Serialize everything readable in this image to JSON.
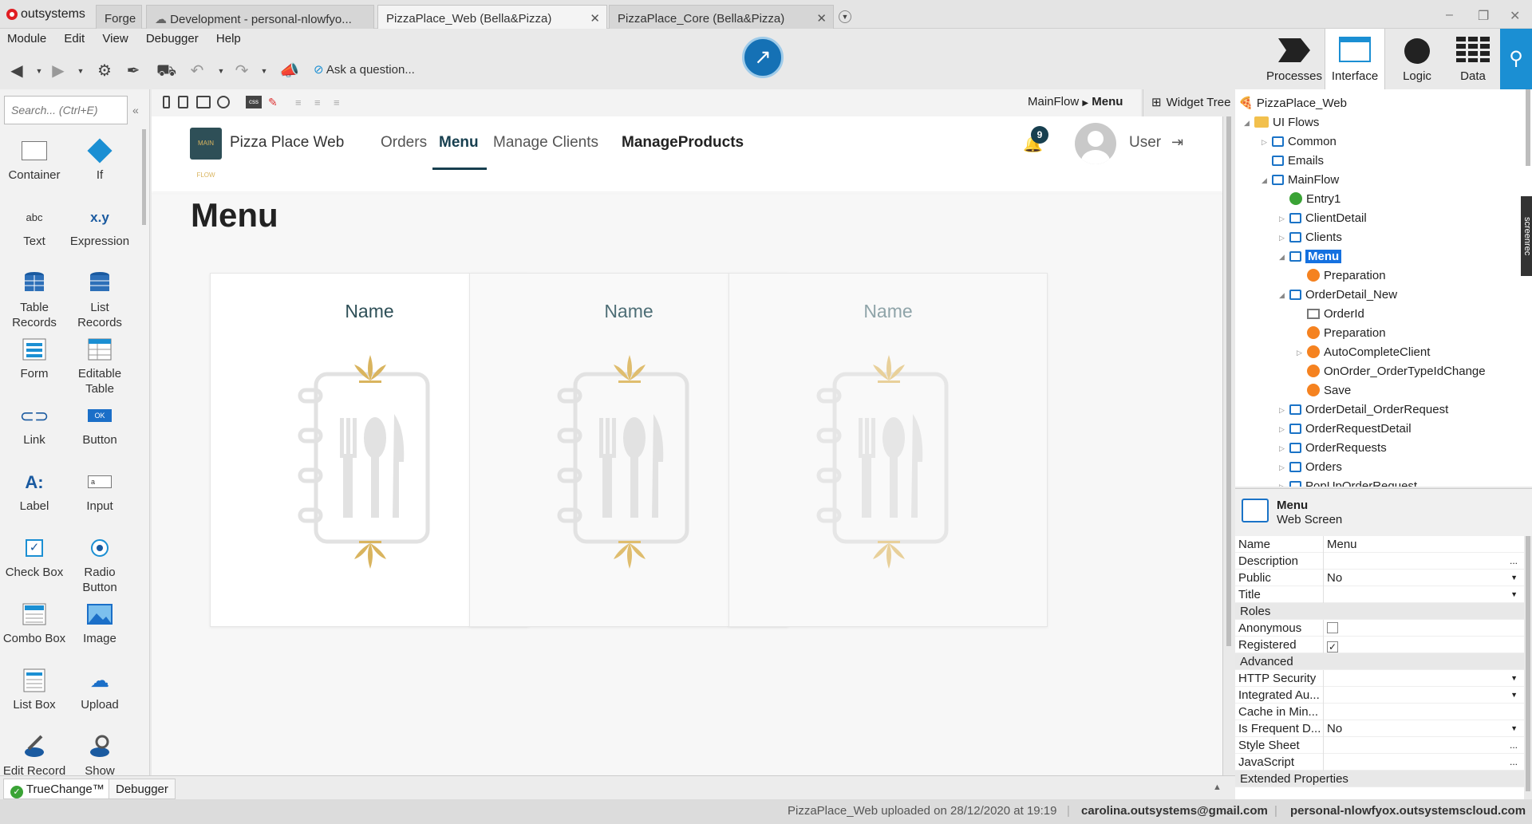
{
  "tabs": {
    "app_logo": "outsystems",
    "items": [
      {
        "label": "Forge"
      },
      {
        "label": "Development - personal-nlowfyo..."
      },
      {
        "label": "PizzaPlace_Web (Bella&Pizza)"
      },
      {
        "label": "PizzaPlace_Core (Bella&Pizza)"
      }
    ]
  },
  "menu": [
    "Module",
    "Edit",
    "View",
    "Debugger",
    "Help"
  ],
  "toolbar": {
    "ask": "Ask a question..."
  },
  "ribbon": {
    "processes": "Processes",
    "interface": "Interface",
    "logic": "Logic",
    "data": "Data"
  },
  "toolbox": {
    "search_placeholder": "Search... (Ctrl+E)",
    "widgets": [
      {
        "label": "Container"
      },
      {
        "label": "If"
      },
      {
        "label": "Text"
      },
      {
        "label": "Expression"
      },
      {
        "label": "Table Records"
      },
      {
        "label": "List Records"
      },
      {
        "label": "Form"
      },
      {
        "label": "Editable Table"
      },
      {
        "label": "Link"
      },
      {
        "label": "Button"
      },
      {
        "label": "Label"
      },
      {
        "label": "Input"
      },
      {
        "label": "Check Box"
      },
      {
        "label": "Radio Button"
      },
      {
        "label": "Combo Box"
      },
      {
        "label": "Image"
      },
      {
        "label": "List Box"
      },
      {
        "label": "Upload"
      },
      {
        "label": "Edit Record"
      },
      {
        "label": "Show"
      }
    ],
    "icons": {
      "text": "abc",
      "expression": "x.y",
      "button": "OK",
      "label": "A:"
    }
  },
  "breadcrumb": {
    "flow": "MainFlow",
    "screen": "Menu"
  },
  "widget_tree": "Widget Tree",
  "page": {
    "app_name": "Pizza Place Web",
    "logo_text": "MAIN FLOW",
    "nav": [
      "Orders",
      "Menu",
      "Manage Clients",
      "ManageProducts"
    ],
    "notification_count": "9",
    "user": "User",
    "title": "Menu",
    "cards": [
      {
        "name": "Name"
      },
      {
        "name": "Name"
      },
      {
        "name": "Name"
      }
    ]
  },
  "tree": [
    {
      "label": "PizzaPlace_Web"
    },
    {
      "label": "UI Flows"
    },
    {
      "label": "Common"
    },
    {
      "label": "Emails"
    },
    {
      "label": "MainFlow"
    },
    {
      "label": "Entry1"
    },
    {
      "label": "ClientDetail"
    },
    {
      "label": "Clients"
    },
    {
      "label": "Menu"
    },
    {
      "label": "Preparation"
    },
    {
      "label": "OrderDetail_New"
    },
    {
      "label": "OrderId"
    },
    {
      "label": "Preparation"
    },
    {
      "label": "AutoCompleteClient"
    },
    {
      "label": "OnOrder_OrderTypeIdChange"
    },
    {
      "label": "Save"
    },
    {
      "label": "OrderDetail_OrderRequest"
    },
    {
      "label": "OrderRequestDetail"
    },
    {
      "label": "OrderRequests"
    },
    {
      "label": "Orders"
    },
    {
      "label": "PopUpOrderRequest"
    }
  ],
  "screenrec": "screenrec",
  "props_header": {
    "name": "Menu",
    "type": "Web Screen"
  },
  "props": [
    {
      "k": "Name",
      "v": "Menu"
    },
    {
      "k": "Description",
      "v": ""
    },
    {
      "k": "Public",
      "v": "No"
    },
    {
      "k": "Title",
      "v": ""
    },
    {
      "k": "Roles",
      "v": ""
    },
    {
      "k": "Anonymous",
      "v": ""
    },
    {
      "k": "Registered",
      "v": ""
    },
    {
      "k": "Advanced",
      "v": ""
    },
    {
      "k": "HTTP Security",
      "v": ""
    },
    {
      "k": "Integrated Au...",
      "v": ""
    },
    {
      "k": "Cache in Min...",
      "v": ""
    },
    {
      "k": "Is Frequent D...",
      "v": "No"
    },
    {
      "k": "Style Sheet",
      "v": ""
    },
    {
      "k": "JavaScript",
      "v": ""
    },
    {
      "k": "Extended Properties",
      "v": ""
    }
  ],
  "bottom_tabs": {
    "truechange": "TrueChange™",
    "debugger": "Debugger"
  },
  "status": {
    "upload": "PizzaPlace_Web uploaded on 28/12/2020 at 19:19",
    "email": "carolina.outsystems@gmail.com",
    "server": "personal-nlowfyox.outsystemscloud.com"
  },
  "colors": {
    "accent": "#1571b5",
    "nav_selected": "#173f4f",
    "gold": "#d9b45e"
  }
}
